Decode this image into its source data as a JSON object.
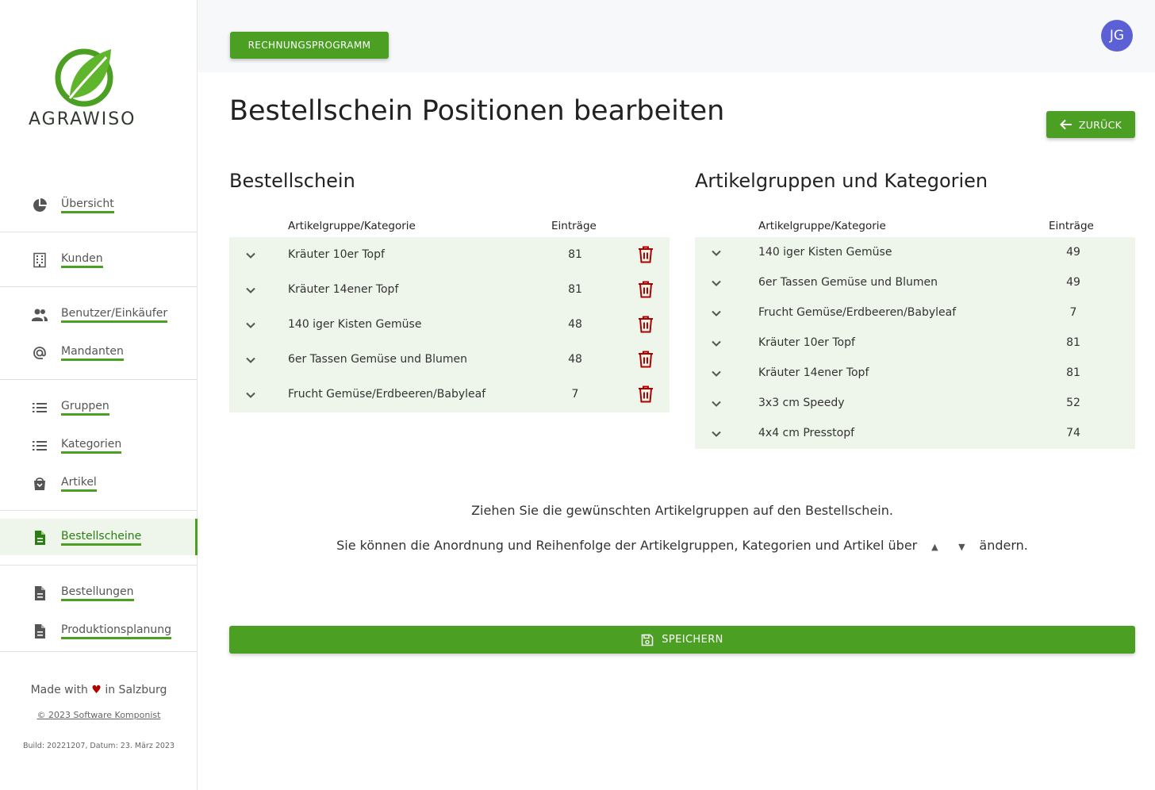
{
  "brand": {
    "name": "AGRAWISO"
  },
  "colors": {
    "accent": "#4b9f22",
    "danger": "#b00000",
    "avatar": "#5b61d4",
    "row_bg": "#eef5ea"
  },
  "sidebar": {
    "items": [
      {
        "label": "Übersicht",
        "icon": "pie-chart-icon"
      },
      {
        "label": "Kunden",
        "icon": "building-icon"
      },
      {
        "label": "Benutzer/Einkäufer",
        "icon": "users-icon"
      },
      {
        "label": "Mandanten",
        "icon": "at-icon"
      },
      {
        "label": "Gruppen",
        "icon": "list-icon"
      },
      {
        "label": "Kategorien",
        "icon": "list-icon"
      },
      {
        "label": "Artikel",
        "icon": "shopping-bag-icon"
      },
      {
        "label": "Bestellscheine",
        "icon": "document-icon",
        "active": true
      },
      {
        "label": "Bestellungen",
        "icon": "document-icon"
      },
      {
        "label": "Produktionsplanung",
        "icon": "document-icon"
      }
    ],
    "footer": {
      "made_prefix": "Made with",
      "made_suffix": "in Salzburg",
      "copyright": "© 2023 Software Komponist",
      "build": "Build: 20221207, Datum: 23. März 2023"
    }
  },
  "topbar": {
    "app_button": "RECHNUNGSPROGRAMM",
    "avatar_initials": "JG"
  },
  "page": {
    "title": "Bestellschein Positionen bearbeiten",
    "back_button": "ZURÜCK",
    "save_button": "SPEICHERN",
    "hint_line1": "Ziehen Sie die gewünschten Artikelgruppen auf den Bestellschein.",
    "hint_line2_prefix": "Sie können die Anordnung und Reihenfolge der Artikelgruppen, Kategorien und Artikel über",
    "hint_line2_suffix": "ändern."
  },
  "left_table": {
    "title": "Bestellschein",
    "col_name": "Artikelgruppe/Kategorie",
    "col_count": "Einträge",
    "rows": [
      {
        "name": "Kräuter 10er Topf",
        "count": "81"
      },
      {
        "name": "Kräuter 14ener Topf",
        "count": "81"
      },
      {
        "name": "140 iger Kisten Gemüse",
        "count": "48"
      },
      {
        "name": "6er Tassen Gemüse und Blumen",
        "count": "48"
      },
      {
        "name": "Frucht Gemüse/Erdbeeren/Babyleaf",
        "count": "7"
      }
    ]
  },
  "right_table": {
    "title": "Artikelgruppen und Kategorien",
    "col_name": "Artikelgruppe/Kategorie",
    "col_count": "Einträge",
    "rows": [
      {
        "name": "140 iger Kisten Gemüse",
        "count": "49"
      },
      {
        "name": "6er Tassen Gemüse und Blumen",
        "count": "49"
      },
      {
        "name": "Frucht Gemüse/Erdbeeren/Babyleaf",
        "count": "7"
      },
      {
        "name": "Kräuter 10er Topf",
        "count": "81"
      },
      {
        "name": "Kräuter 14ener Topf",
        "count": "81"
      },
      {
        "name": "3x3 cm Speedy",
        "count": "52"
      },
      {
        "name": "4x4 cm Presstopf",
        "count": "74"
      }
    ]
  }
}
